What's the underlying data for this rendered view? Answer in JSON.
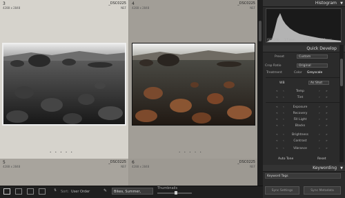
{
  "grid": {
    "cells": [
      {
        "num": "3",
        "dims": "4288 x 2848",
        "name": "_DSC0225",
        "type": "NEF"
      },
      {
        "num": "4",
        "dims": "4288 x 2848",
        "name": "_DSC0225",
        "type": "NEF"
      },
      {
        "num": "5",
        "dims": "4288 x 2848",
        "name": "_DSC0225",
        "type": "NEF"
      },
      {
        "num": "6",
        "dims": "4288 x 2848",
        "name": "_DSC0225",
        "type": "NEF"
      }
    ]
  },
  "toolbar": {
    "sort_label": "Sort:",
    "sort_value": "User Order",
    "filter_value": "Bikes, Summer,",
    "thumbnails_label": "Thumbnails"
  },
  "histogram": {
    "title": "Histogram",
    "iso": "ISO 100",
    "focal": "17 mm",
    "aperture": "f / 20",
    "shutter": "30 sec"
  },
  "quick_develop": {
    "title": "Quick Develop",
    "preset_label": "Preset",
    "preset_value": "Custom",
    "crop_label": "Crop Ratio",
    "crop_value": "Original",
    "treatment_label": "Treatment",
    "treatment_color": "Color",
    "treatment_gray": "Greyscale",
    "wb_label": "WB",
    "wb_value": "As Shot",
    "rows": [
      "Temp",
      "Tint",
      "Exposure",
      "Recovery",
      "Fill Light",
      "Blacks",
      "Brightness",
      "Contrast",
      "Vibrance"
    ],
    "auto_tone": "Auto Tone",
    "reset": "Reset"
  },
  "keywording": {
    "title": "Keywording",
    "tags_label": "Keyword Tags",
    "sync_settings": "Sync Settings",
    "sync_metadata": "Sync Metadata"
  }
}
